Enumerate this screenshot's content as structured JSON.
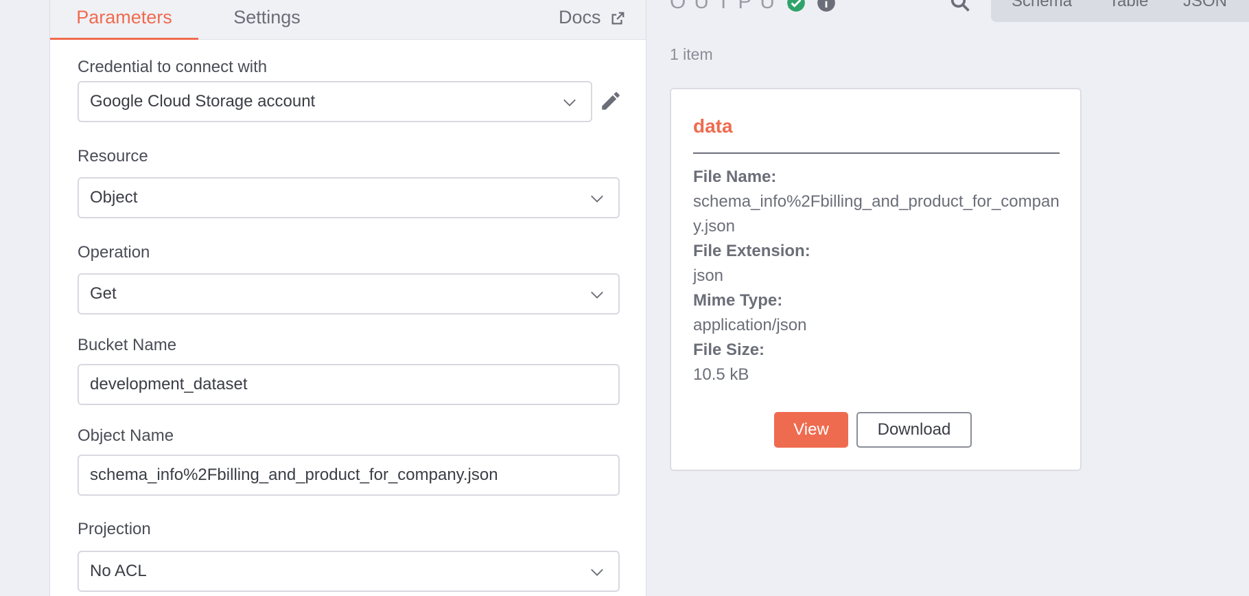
{
  "tabs": {
    "parameters": "Parameters",
    "settings": "Settings",
    "docs": "Docs"
  },
  "form": {
    "credential": {
      "label": "Credential to connect with",
      "value": "Google Cloud Storage account"
    },
    "resource": {
      "label": "Resource",
      "value": "Object"
    },
    "operation": {
      "label": "Operation",
      "value": "Get"
    },
    "bucket": {
      "label": "Bucket Name",
      "value": "development_dataset"
    },
    "object": {
      "label": "Object Name",
      "value": "schema_info%2Fbilling_and_product_for_company.json"
    },
    "projection": {
      "label": "Projection",
      "value": "No ACL"
    }
  },
  "output": {
    "header": "OUTPUT",
    "views": {
      "schema": "Schema",
      "table": "Table",
      "json": "JSON"
    },
    "item_count": "1 item",
    "card": {
      "title": "data",
      "fields": [
        {
          "key": "File Name:",
          "value": "schema_info%2Fbilling_and_product_for_company.json"
        },
        {
          "key": "File Extension:",
          "value": "json"
        },
        {
          "key": "Mime Type:",
          "value": "application/json"
        },
        {
          "key": "File Size:",
          "value": "10.5 kB"
        }
      ],
      "view_button": "View",
      "download_button": "Download"
    }
  },
  "colors": {
    "accent": "#ef6b4f",
    "success": "#2fa36b",
    "muted": "#6b6e78"
  }
}
